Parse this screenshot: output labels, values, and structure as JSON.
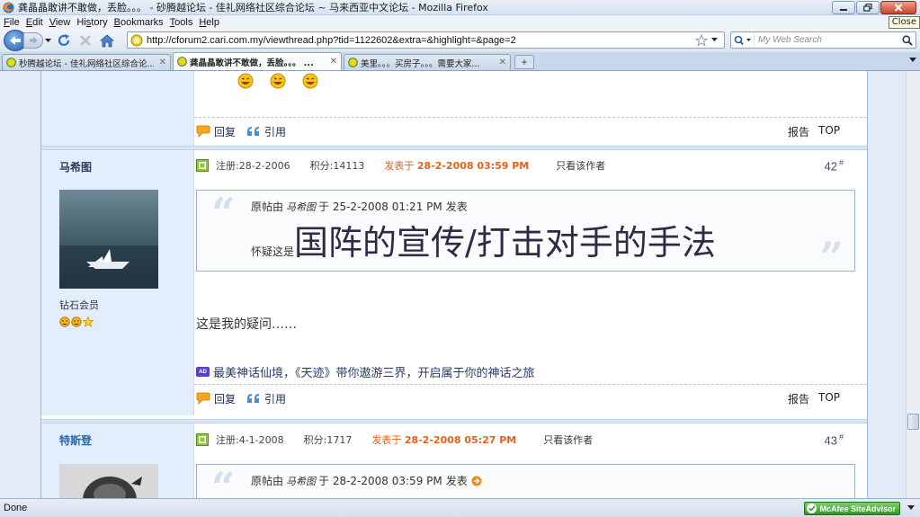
{
  "window": {
    "title": "龚晶晶敢讲不敢做，丢脸。。。 - 砂腾越论坛 - 佳礼网络社区综合论坛 ~ 马来西亚中文论坛 - Mozilla Firefox",
    "close_tooltip": "Close"
  },
  "menu": {
    "items": [
      {
        "label": "File",
        "underline_index": 0
      },
      {
        "label": "Edit",
        "underline_index": 0
      },
      {
        "label": "View",
        "underline_index": 0
      },
      {
        "label": "History",
        "underline_index": 2
      },
      {
        "label": "Bookmarks",
        "underline_index": 0
      },
      {
        "label": "Tools",
        "underline_index": 0
      },
      {
        "label": "Help",
        "underline_index": 0
      }
    ]
  },
  "navbar": {
    "url": "http://cforum2.cari.com.my/viewthread.php?tid=1122602&extra=&highlight=&page=2",
    "search_placeholder": "My Web Search"
  },
  "tabs": [
    {
      "label": "秒腾越论坛 - 佳礼网络社区综合论...",
      "active": false
    },
    {
      "label": "龚晶晶敢讲不敢做，丢脸。。。 ...",
      "active": true
    },
    {
      "label": "美里。。。买房子。。。需要大家...",
      "active": false
    }
  ],
  "prev_post": {
    "actions": {
      "reply": "回复",
      "quote": "引用",
      "report": "报告",
      "top": "TOP"
    }
  },
  "post42": {
    "author": "马希图",
    "rank": "钻石会员",
    "registered": "注册:28-2-2006",
    "points": "积分:14113",
    "posted_prefix": "发表于",
    "posted_at": "28-2-2008 03:59 PM",
    "only_author": "只看该作者",
    "floor": "42",
    "floor_mark": "#",
    "quote": {
      "lead": "原帖由",
      "author": "马希图",
      "time": "于 25-2-2008 01:21 PM",
      "suffix": "发表",
      "prefix": "怀疑这是",
      "headline": "国阵的宣传/打击对手的手法"
    },
    "body": "这是我的疑问……",
    "ad": {
      "badge": "AD",
      "text": "最美神话仙境，《天迹》带你遨游三界，开启属于你的神话之旅"
    },
    "actions": {
      "reply": "回复",
      "quote": "引用",
      "report": "报告",
      "top": "TOP"
    }
  },
  "post43": {
    "author": "特斯登",
    "registered": "注册:4-1-2008",
    "points": "积分:1717",
    "posted_prefix": "发表于",
    "posted_at": "28-2-2008 05:27 PM",
    "only_author": "只看该作者",
    "floor": "43",
    "floor_mark": "#",
    "quote": {
      "lead": "原帖由",
      "author": "马希图",
      "time": "于 28-2-2008 03:59 PM",
      "suffix": "发表"
    }
  },
  "status": {
    "text": "Done",
    "siteadvisor": "McAfee SiteAdvisor"
  },
  "colors": {
    "posted_time": "#e2621b",
    "author_col_bg": "#e2eefb",
    "forum_border": "#9fbbdc",
    "headline": "#2c2c48"
  }
}
